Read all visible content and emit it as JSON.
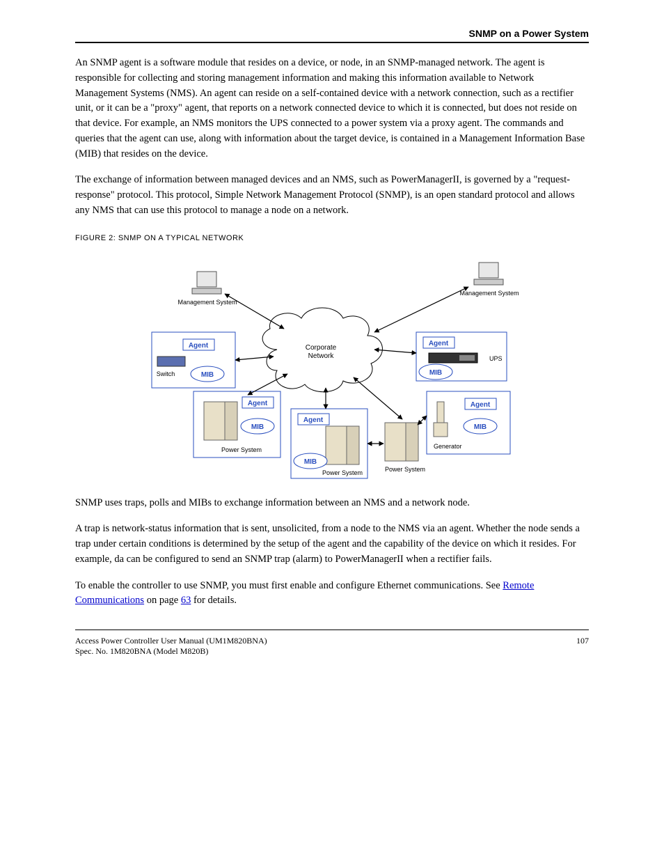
{
  "header": {
    "page_label": "SNMP on a Power System"
  },
  "para1": "An SNMP agent is a software module that resides on a device, or node, in an SNMP-managed network. The agent is responsible for collecting and storing management information and making this information available to Network Management Systems (NMS). An agent can reside on a self-contained device with a network connection, such as a rectifier unit, or it can be a \"proxy\" agent, that reports on a network connected device to which it is connected, but does not reside on that device. For example, an NMS monitors the UPS connected to a power system via a proxy agent. The commands and queries that the agent can use, along with information about the target device, is contained in a Management Information Base (MIB) that resides on the device.",
  "para2": "The exchange of information between managed devices and an NMS, such as PowerManagerII, is governed by a \"request-response\" protocol. This protocol, Simple Network Management Protocol (SNMP), is an open standard protocol and allows any NMS that can use this protocol to manage a node on a network.",
  "figure_label": "FIGURE 2: SNMP ON A TYPICAL NETWORK",
  "diagram": {
    "mgmt_left": "Management System",
    "mgmt_right": "Management System",
    "cloud": "Corporate\nNetwork",
    "agent": "Agent",
    "mib": "MIB",
    "switch": "Switch",
    "ups": "UPS",
    "power_system": "Power System",
    "generator": "Generator"
  },
  "para3_a": "SNMP uses traps, polls and MIBs to exchange information between an NMS and a network node.",
  "para3_b": "A trap is network-status information that is sent, unsolicited, from a node to the NMS via an agent. Whether the node sends a trap under certain conditions is determined by the setup of the agent and the capability of the device on which it resides. For example, da can be configured to send an SNMP trap (alarm) to PowerManagerII when a rectifier fails.",
  "para4_prefix": "To enable the controller to use SNMP, you must first enable and configure Ethernet communications. See ",
  "para4_link": "Remote Communications",
  "para4_mid": " on page ",
  "para4_page": "63",
  "para4_suffix": " for details.",
  "footer": {
    "doc": "Access Power Controller User Manual (UM1M820BNA)",
    "spec": "Spec. No. 1M820BNA (Model M820B)",
    "page": "107"
  }
}
